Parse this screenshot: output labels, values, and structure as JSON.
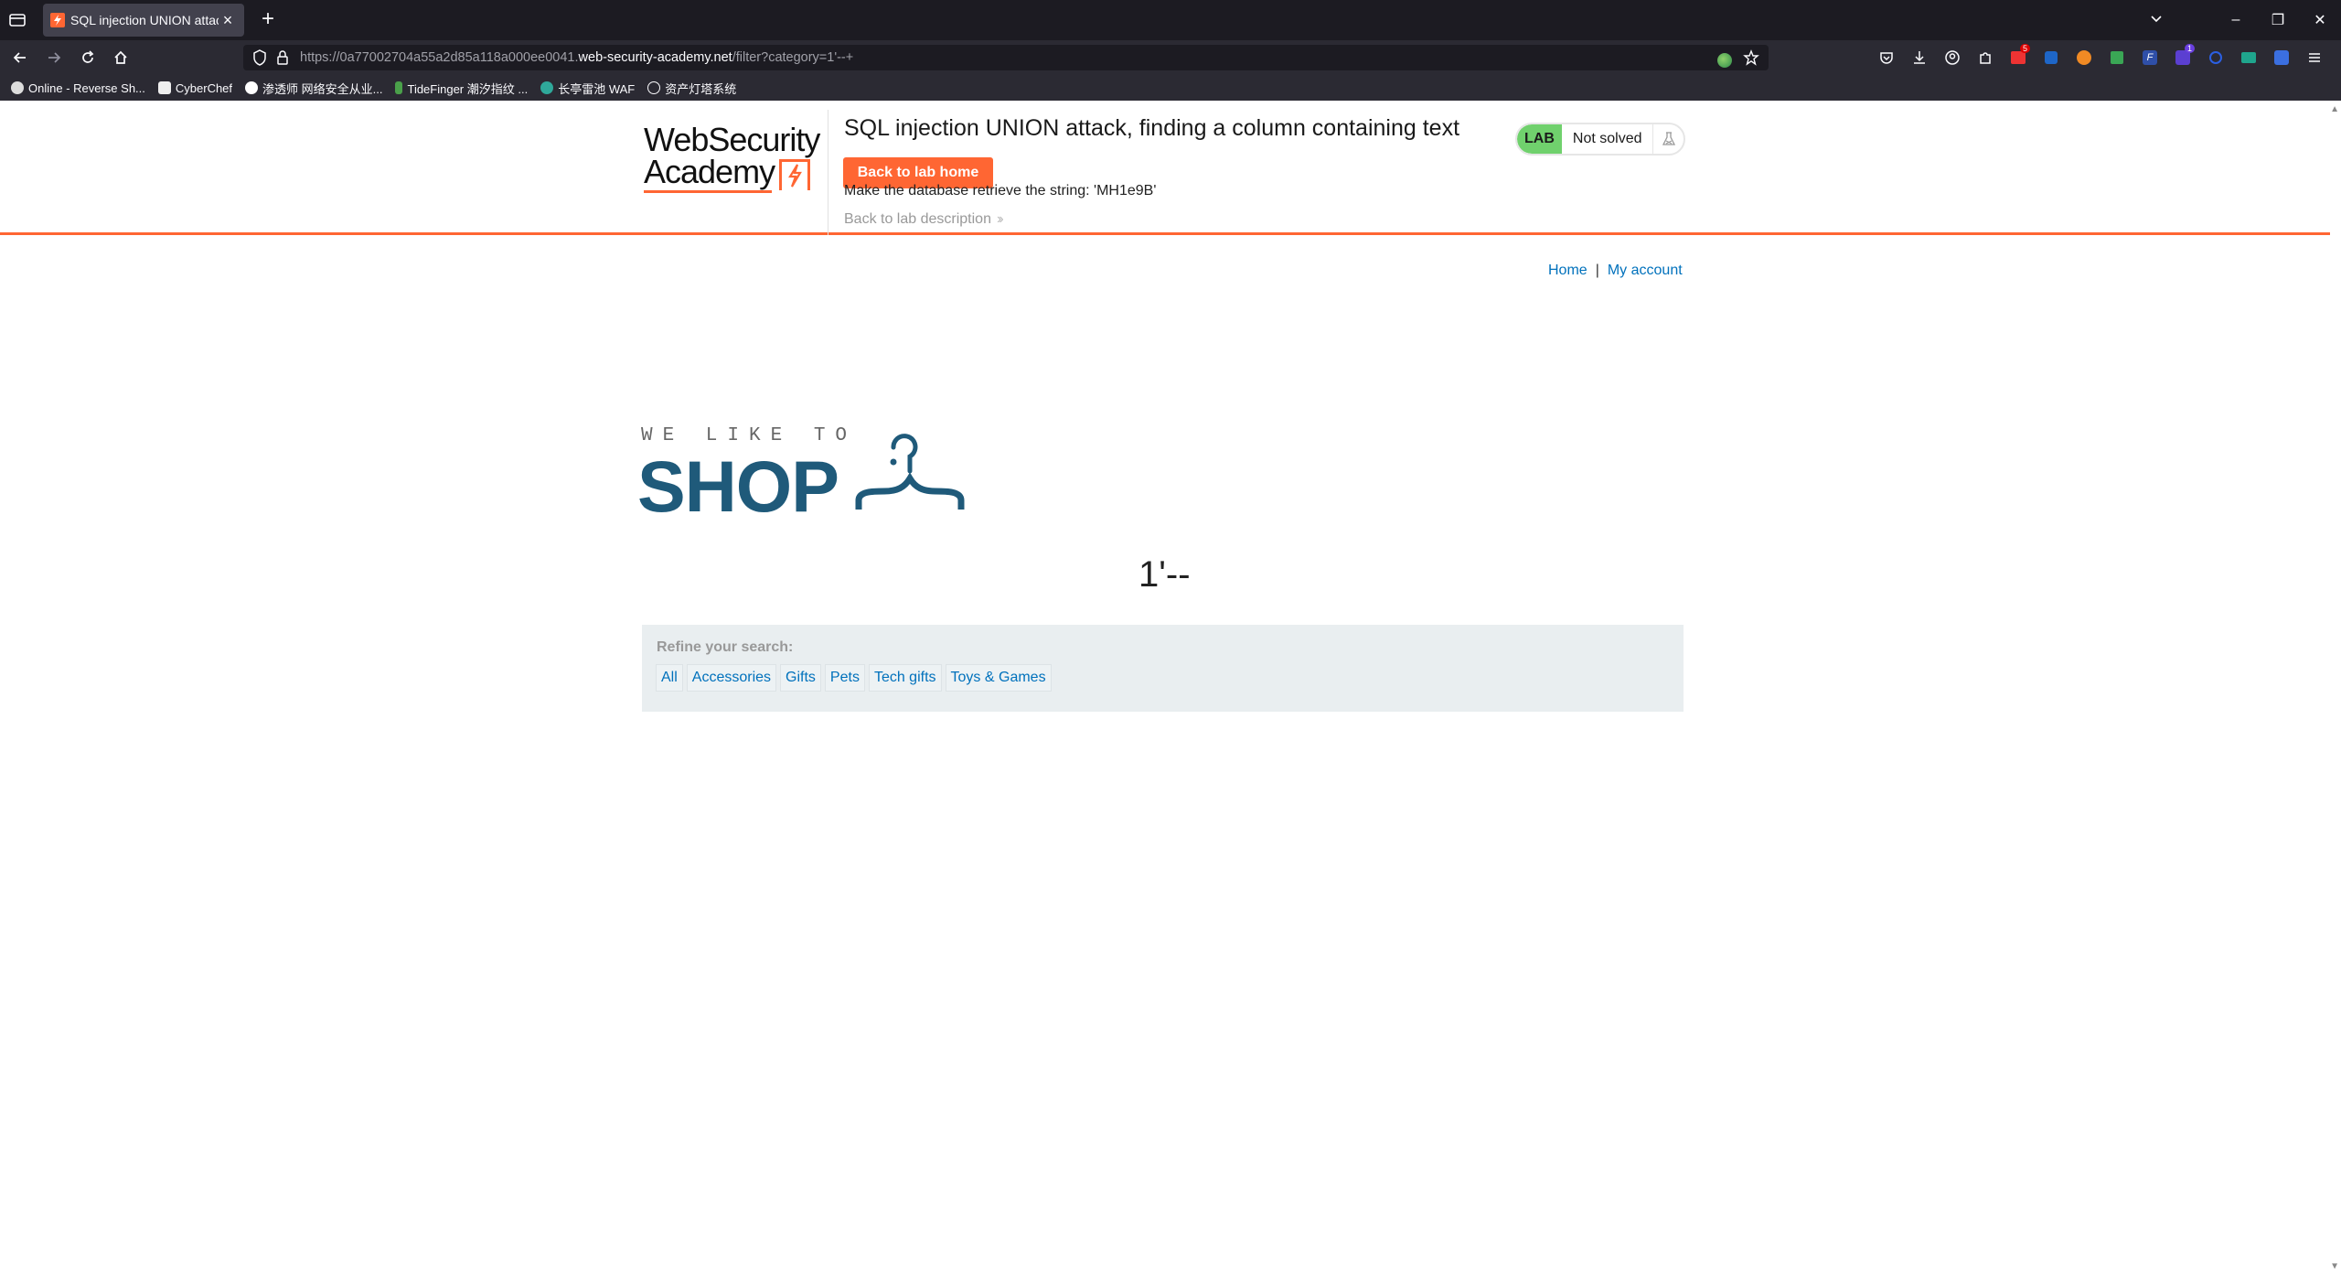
{
  "browser": {
    "tab_title": "SQL injection UNION attack",
    "url_prefix": "https://0a77002704a55a2d85a118a000ee0041.",
    "url_domain": "web-security-academy.net",
    "url_suffix": "/filter?category=1'--+",
    "bookmarks": [
      {
        "label": "Online - Reverse Sh...",
        "icon": "skull-icon"
      },
      {
        "label": "CyberChef",
        "icon": "chef-hat-icon"
      },
      {
        "label": "渗透师 网络安全从业...",
        "icon": "bookmark-icon"
      },
      {
        "label": "TideFinger 潮汐指纹 ...",
        "icon": "bookmark-icon"
      },
      {
        "label": "长亭雷池 WAF",
        "icon": "bookmark-icon"
      },
      {
        "label": "资产灯塔系统",
        "icon": "globe-icon"
      }
    ],
    "extension_badges": {
      "mail": "5",
      "purple": "1"
    }
  },
  "lab": {
    "logo_line1": "WebSecurity",
    "logo_line2": "Academy",
    "title": "SQL injection UNION attack, finding a column containing text",
    "back_button": "Back to lab home",
    "description": "Make the database retrieve the string: 'MH1e9B'",
    "back_description": "Back to lab description",
    "badge_label": "LAB",
    "status": "Not solved"
  },
  "nav": {
    "home": "Home",
    "separator": "|",
    "account": "My account"
  },
  "shop_logo": {
    "tagline": "WE LIKE TO",
    "word": "SHOP"
  },
  "search_heading": "1'--",
  "refine": {
    "label": "Refine your search:",
    "filters": [
      "All",
      "Accessories",
      "Gifts",
      "Pets",
      "Tech gifts",
      "Toys & Games"
    ]
  },
  "colors": {
    "accent": "#ff6633",
    "link": "#0071bc",
    "shop_blue": "#1f5a7a",
    "lab_green": "#70d16d"
  }
}
